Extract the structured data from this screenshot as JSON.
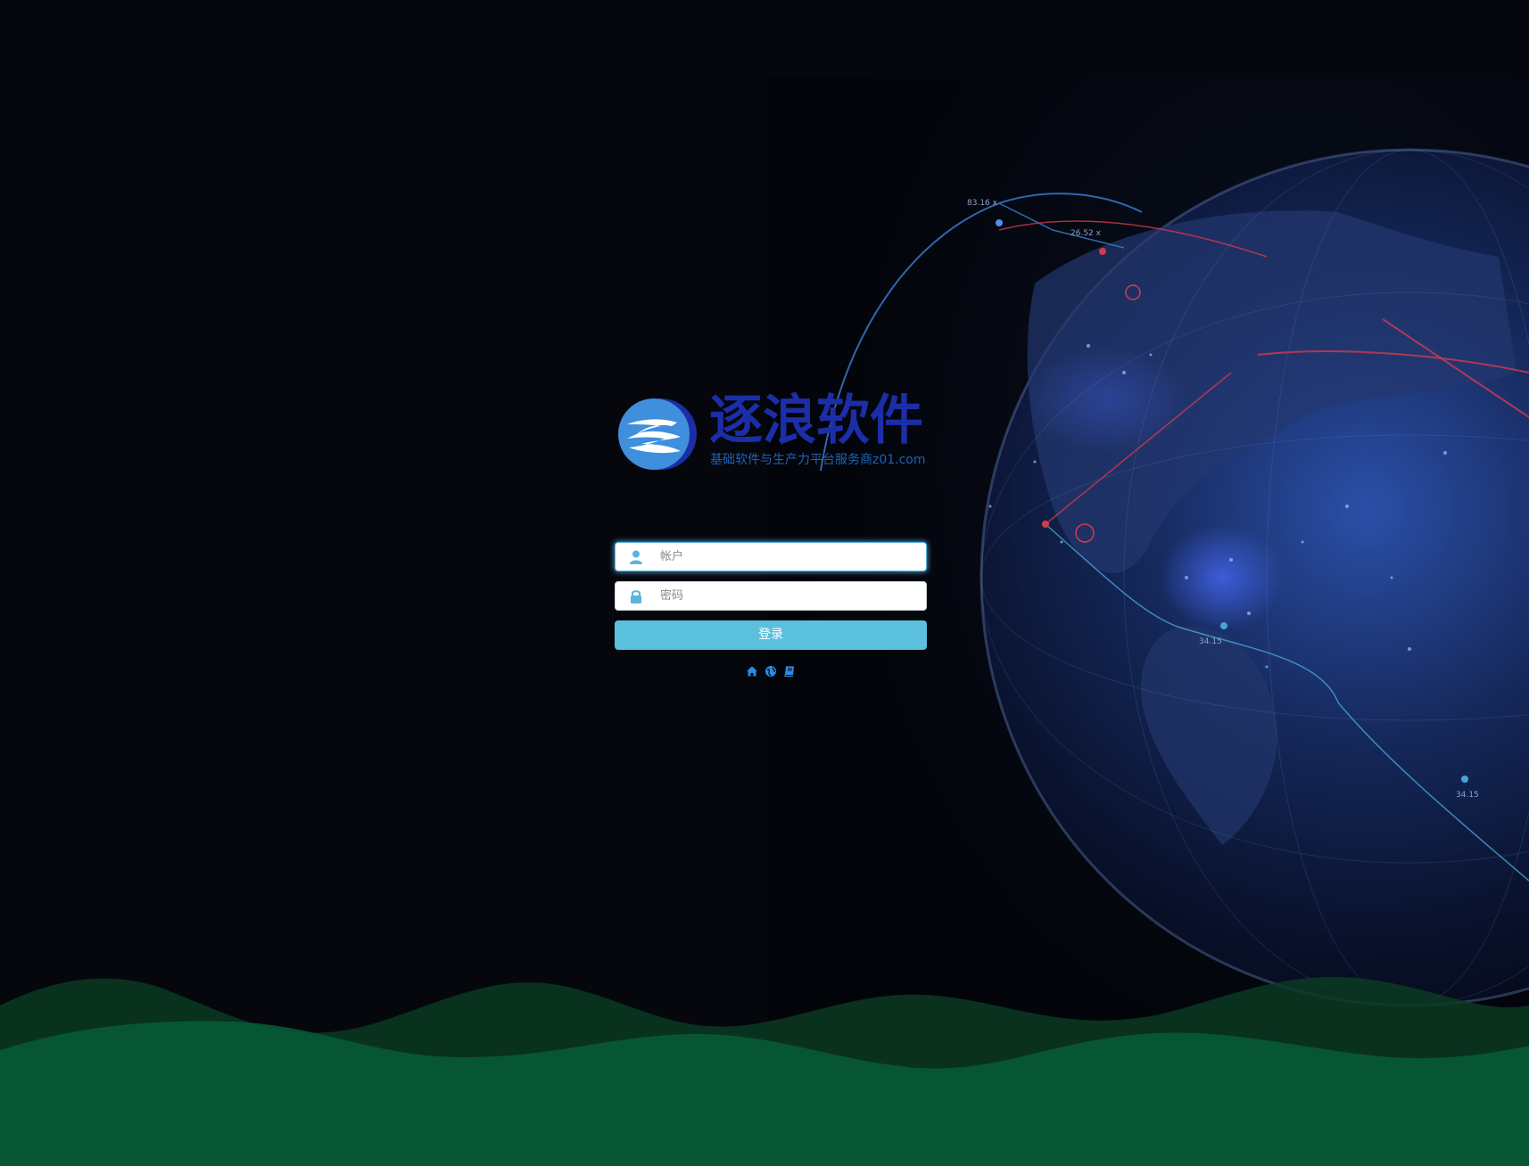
{
  "brand": {
    "title": "逐浪软件",
    "subtitle": "基础软件与生产力平台服务商z01.com"
  },
  "form": {
    "account_placeholder": "帐户",
    "password_placeholder": "密码",
    "login_label": "登录"
  },
  "footer_links": [
    {
      "icon": "home-icon"
    },
    {
      "icon": "globe-icon"
    },
    {
      "icon": "book-icon"
    }
  ],
  "globe_labels": [
    "83.16 x",
    "26.52 x",
    "34.15",
    "34.15"
  ],
  "colors": {
    "background": "#06070d",
    "brand_blue": "#1b2ea8",
    "accent": "#5bc0de",
    "wave_dark": "#0a3a22",
    "wave_light": "#075a35"
  }
}
